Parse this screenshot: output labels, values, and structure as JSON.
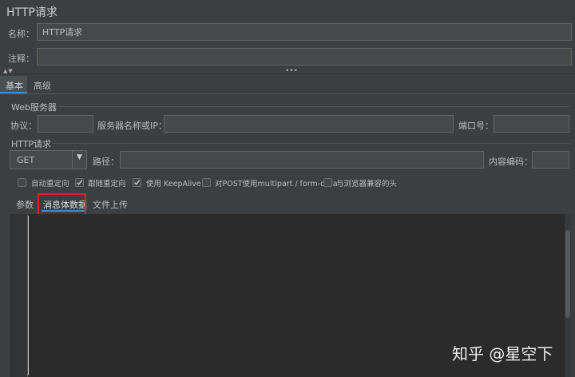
{
  "title": "HTTP请求",
  "name_row": {
    "label": "名称：",
    "value": "HTTP请求"
  },
  "comment_row": {
    "label": "注释：",
    "value": ""
  },
  "main_tabs": [
    {
      "label": "基本",
      "active": true
    },
    {
      "label": "高级",
      "active": false
    }
  ],
  "web_server": {
    "section_title": "Web服务器",
    "protocol_label": "协议：",
    "protocol_value": "",
    "server_label": "服务器名称或IP：",
    "server_value": "",
    "port_label": "端口号：",
    "port_value": ""
  },
  "http_request": {
    "section_title": "HTTP请求",
    "method_value": "GET",
    "path_label": "路径：",
    "path_value": "",
    "encoding_label": "内容编码：",
    "encoding_value": ""
  },
  "options": [
    {
      "label": "自动重定向",
      "checked": false
    },
    {
      "label": "跟随重定向",
      "checked": true
    },
    {
      "label": "使用 KeepAlive",
      "checked": true
    },
    {
      "label": "对POST使用multipart / form-data",
      "checked": false
    },
    {
      "label": "与浏览器兼容的头",
      "checked": false
    }
  ],
  "sub_tabs": [
    {
      "label": "参数",
      "active": false
    },
    {
      "label": "消息体数据",
      "active": true
    },
    {
      "label": "文件上传",
      "active": false
    }
  ],
  "watermark": "知乎 @星空下",
  "colors": {
    "background": "#3c3f41",
    "field": "#45494a",
    "editor": "#2b2b2b",
    "accent": "#4a88c7",
    "highlight_box": "#e0212c"
  }
}
